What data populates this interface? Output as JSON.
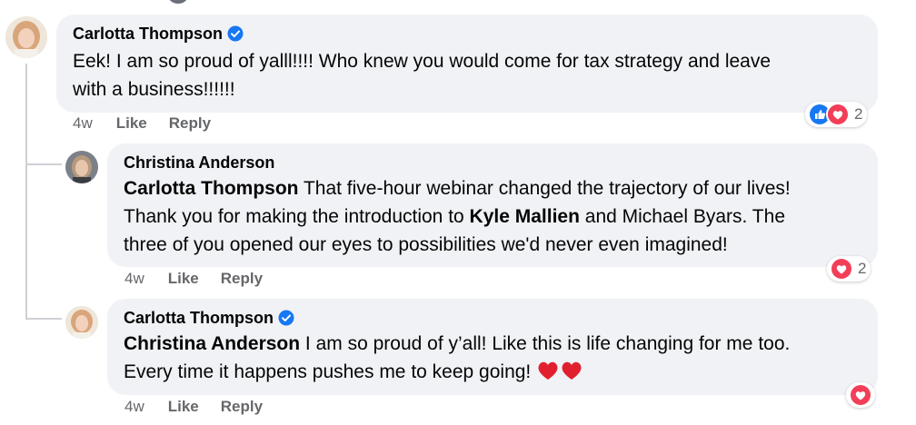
{
  "comments": [
    {
      "author": "Carlotta Thompson",
      "verified": true,
      "text_lines": [
        "Eek! I am so proud of yalll!!!! Who knew you would come for tax strategy and leave",
        "with a business!!!!!!"
      ],
      "time": "4w",
      "like_label": "Like",
      "reply_label": "Reply",
      "reactions": {
        "types": [
          "like",
          "love"
        ],
        "count": "2"
      }
    },
    {
      "author": "Christina Anderson",
      "verified": false,
      "mention": "Carlotta Thompson",
      "text_line1_rest": " That five-hour webinar changed the trajectory of our lives!",
      "text_line2_pre": "Thank you for making the introduction to ",
      "text_line2_mention": "Kyle Mallien",
      "text_line2_post": " and Michael Byars. The",
      "text_line3": "three of you opened our eyes to possibilities we'd never even imagined!",
      "time": "4w",
      "like_label": "Like",
      "reply_label": "Reply",
      "reactions": {
        "types": [
          "love"
        ],
        "count": "2"
      }
    },
    {
      "author": "Carlotta Thompson",
      "verified": true,
      "mention": "Christina Anderson",
      "text_line1_rest": " I am so proud of y’all! Like this is life changing for me too.",
      "text_line2": "Every time it happens pushes me to keep going! ",
      "emoji": [
        "red-heart",
        "red-heart"
      ],
      "time": "4w",
      "like_label": "Like",
      "reply_label": "Reply",
      "reactions": {
        "types": [
          "love"
        ],
        "count": ""
      }
    }
  ],
  "colors": {
    "bubble": "#f0f2f5",
    "meta_text": "#65676b",
    "verified_blue": "#1877f2",
    "love_red": "#f33e58"
  }
}
